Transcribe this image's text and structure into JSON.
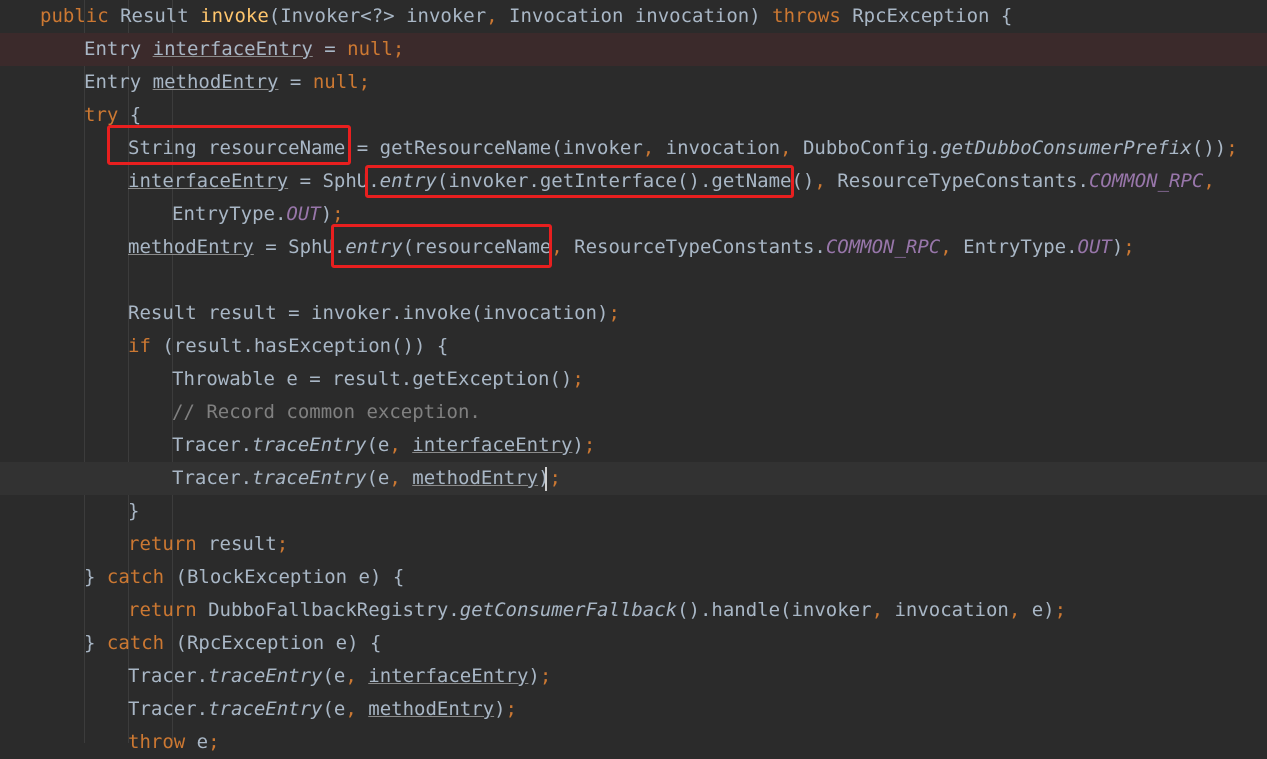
{
  "editor": {
    "language": "java",
    "colors": {
      "background": "#2b2b2b",
      "keyword": "#cc7832",
      "method_decl": "#ffc66d",
      "text": "#a9b7c6",
      "constant": "#9876aa",
      "comment": "#808080",
      "highlight_box": "#e81f1f"
    },
    "lines": [
      {
        "tokens": [
          {
            "t": "public",
            "c": "kw"
          },
          {
            "t": " Result ",
            "c": "txt"
          },
          {
            "t": "invoke",
            "c": "fn"
          },
          {
            "t": "(Invoker<?> invoker",
            "c": "txt"
          },
          {
            "t": ", ",
            "c": "punc"
          },
          {
            "t": "Invocation invocation) ",
            "c": "txt"
          },
          {
            "t": "throws",
            "c": "kw"
          },
          {
            "t": " RpcException {",
            "c": "txt"
          }
        ]
      },
      {
        "style": "error",
        "tokens": [
          {
            "t": "Entry ",
            "c": "txt"
          },
          {
            "t": "interfaceEntry",
            "c": "fld"
          },
          {
            "t": " = ",
            "c": "txt"
          },
          {
            "t": "null;",
            "c": "kw"
          }
        ]
      },
      {
        "tokens": [
          {
            "t": "Entry ",
            "c": "txt"
          },
          {
            "t": "methodEntry",
            "c": "fld"
          },
          {
            "t": " = ",
            "c": "txt"
          },
          {
            "t": "null;",
            "c": "kw"
          }
        ]
      },
      {
        "tokens": [
          {
            "t": "try",
            "c": "kw"
          },
          {
            "t": " {",
            "c": "txt"
          }
        ]
      },
      {
        "tokens": [
          {
            "t": "String resourceName = getResourceName(invoker",
            "c": "txt"
          },
          {
            "t": ", ",
            "c": "punc"
          },
          {
            "t": "invocation",
            "c": "txt"
          },
          {
            "t": ", ",
            "c": "punc"
          },
          {
            "t": "DubboConfig.",
            "c": "txt"
          },
          {
            "t": "getDubboConsumerPrefix",
            "c": "it"
          },
          {
            "t": "())",
            "c": "txt"
          },
          {
            "t": ";",
            "c": "punc"
          }
        ]
      },
      {
        "tokens": [
          {
            "t": "interfaceEntry",
            "c": "fld"
          },
          {
            "t": " = SphU.",
            "c": "txt"
          },
          {
            "t": "entry",
            "c": "it"
          },
          {
            "t": "(invoker.getInterface().getName()",
            "c": "txt"
          },
          {
            "t": ", ",
            "c": "punc"
          },
          {
            "t": "ResourceTypeConstants.",
            "c": "txt"
          },
          {
            "t": "COMMON_RPC",
            "c": "const"
          },
          {
            "t": ",",
            "c": "punc"
          }
        ]
      },
      {
        "tokens": [
          {
            "t": "EntryType.",
            "c": "txt"
          },
          {
            "t": "OUT",
            "c": "const"
          },
          {
            "t": ")",
            "c": "txt"
          },
          {
            "t": ";",
            "c": "punc"
          }
        ]
      },
      {
        "tokens": [
          {
            "t": "methodEntry",
            "c": "fld"
          },
          {
            "t": " = SphU.",
            "c": "txt"
          },
          {
            "t": "entry",
            "c": "it"
          },
          {
            "t": "(resourceName",
            "c": "txt"
          },
          {
            "t": ", ",
            "c": "punc"
          },
          {
            "t": "ResourceTypeConstants.",
            "c": "txt"
          },
          {
            "t": "COMMON_RPC",
            "c": "const"
          },
          {
            "t": ", ",
            "c": "punc"
          },
          {
            "t": "EntryType.",
            "c": "txt"
          },
          {
            "t": "OUT",
            "c": "const"
          },
          {
            "t": ")",
            "c": "txt"
          },
          {
            "t": ";",
            "c": "punc"
          }
        ]
      },
      {
        "tokens": []
      },
      {
        "tokens": [
          {
            "t": "Result result = invoker.invoke(invocation)",
            "c": "txt"
          },
          {
            "t": ";",
            "c": "punc"
          }
        ]
      },
      {
        "tokens": [
          {
            "t": "if",
            "c": "kw"
          },
          {
            "t": " (result.hasException()) {",
            "c": "txt"
          }
        ]
      },
      {
        "tokens": [
          {
            "t": "Throwable e = result.getException()",
            "c": "txt"
          },
          {
            "t": ";",
            "c": "punc"
          }
        ]
      },
      {
        "tokens": [
          {
            "t": "// Record common exception.",
            "c": "cmt"
          }
        ]
      },
      {
        "tokens": [
          {
            "t": "Tracer.",
            "c": "txt"
          },
          {
            "t": "traceEntry",
            "c": "it"
          },
          {
            "t": "(e",
            "c": "txt"
          },
          {
            "t": ", ",
            "c": "punc"
          },
          {
            "t": "interfaceEntry",
            "c": "fld"
          },
          {
            "t": ")",
            "c": "txt"
          },
          {
            "t": ";",
            "c": "punc"
          }
        ]
      },
      {
        "style": "caret",
        "tokens": [
          {
            "t": "Tracer.",
            "c": "txt"
          },
          {
            "t": "traceEntry",
            "c": "it"
          },
          {
            "t": "(e",
            "c": "txt"
          },
          {
            "t": ", ",
            "c": "punc"
          },
          {
            "t": "methodEntry",
            "c": "fld"
          },
          {
            "t": ")",
            "c": "txt"
          },
          {
            "t": ";",
            "c": "punc"
          }
        ]
      },
      {
        "tokens": [
          {
            "t": "}",
            "c": "txt"
          }
        ]
      },
      {
        "tokens": [
          {
            "t": "return",
            "c": "kw"
          },
          {
            "t": " result",
            "c": "txt"
          },
          {
            "t": ";",
            "c": "punc"
          }
        ]
      },
      {
        "tokens": [
          {
            "t": "} ",
            "c": "txt"
          },
          {
            "t": "catch",
            "c": "kw"
          },
          {
            "t": " (BlockException e) {",
            "c": "txt"
          }
        ]
      },
      {
        "tokens": [
          {
            "t": "return",
            "c": "kw"
          },
          {
            "t": " DubboFallbackRegistry.",
            "c": "txt"
          },
          {
            "t": "getConsumerFallback",
            "c": "it"
          },
          {
            "t": "().handle(invoker",
            "c": "txt"
          },
          {
            "t": ", ",
            "c": "punc"
          },
          {
            "t": "invocation",
            "c": "txt"
          },
          {
            "t": ", ",
            "c": "punc"
          },
          {
            "t": "e)",
            "c": "txt"
          },
          {
            "t": ";",
            "c": "punc"
          }
        ]
      },
      {
        "tokens": [
          {
            "t": "} ",
            "c": "txt"
          },
          {
            "t": "catch",
            "c": "kw"
          },
          {
            "t": " (RpcException e) {",
            "c": "txt"
          }
        ]
      },
      {
        "tokens": [
          {
            "t": "Tracer.",
            "c": "txt"
          },
          {
            "t": "traceEntry",
            "c": "it"
          },
          {
            "t": "(e",
            "c": "txt"
          },
          {
            "t": ", ",
            "c": "punc"
          },
          {
            "t": "interfaceEntry",
            "c": "fld"
          },
          {
            "t": ")",
            "c": "txt"
          },
          {
            "t": ";",
            "c": "punc"
          }
        ]
      },
      {
        "tokens": [
          {
            "t": "Tracer.",
            "c": "txt"
          },
          {
            "t": "traceEntry",
            "c": "it"
          },
          {
            "t": "(e",
            "c": "txt"
          },
          {
            "t": ", ",
            "c": "punc"
          },
          {
            "t": "methodEntry",
            "c": "fld"
          },
          {
            "t": ")",
            "c": "txt"
          },
          {
            "t": ";",
            "c": "punc"
          }
        ]
      },
      {
        "tokens": [
          {
            "t": "throw",
            "c": "kw"
          },
          {
            "t": " e",
            "c": "txt"
          },
          {
            "t": ";",
            "c": "punc"
          }
        ]
      }
    ]
  }
}
